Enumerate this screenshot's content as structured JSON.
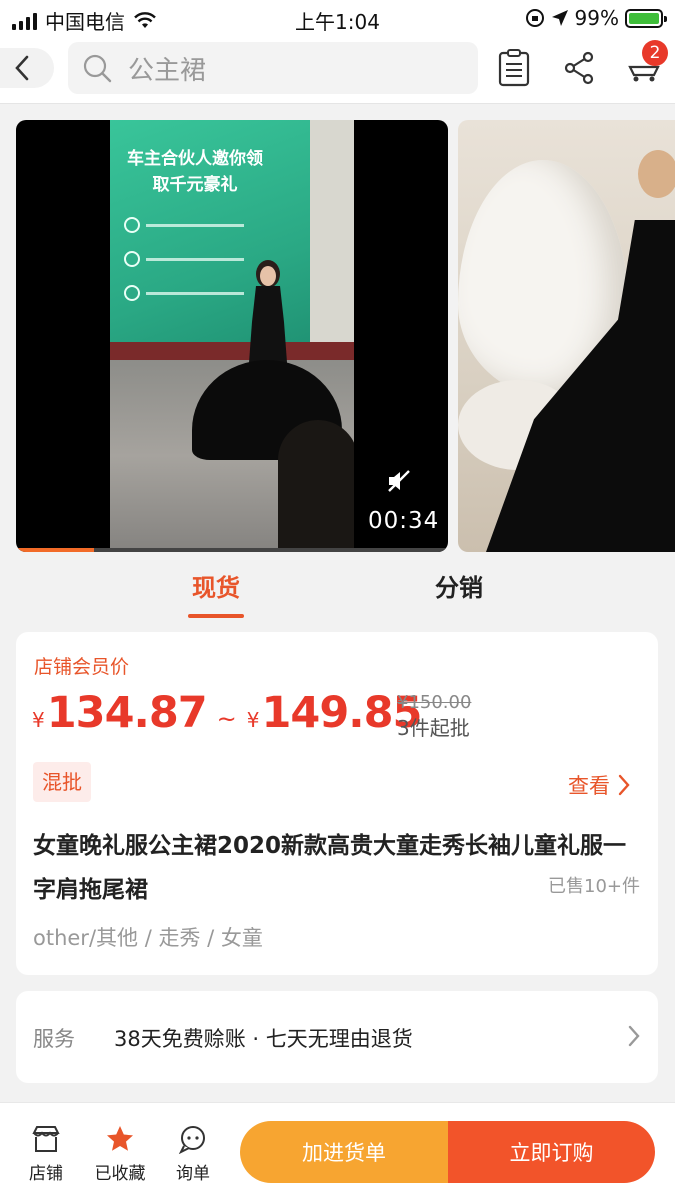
{
  "status_bar": {
    "carrier": "中国电信",
    "time": "上午1:04",
    "battery": "99%",
    "battery_level": 0.99
  },
  "header": {
    "search_placeholder": "公主裙",
    "cart_badge": "2",
    "icons": [
      "back-arrow-icon",
      "search-icon",
      "clipboard-icon",
      "share-icon",
      "cart-icon"
    ]
  },
  "media": {
    "video_screen_title": "车主合伙人邀你领取千元豪礼",
    "video_time": "00:34",
    "video_progress": 0.18
  },
  "tabs": [
    {
      "label": "现货",
      "active": true
    },
    {
      "label": "分销",
      "active": false
    }
  ],
  "product": {
    "member_price_label": "店铺会员价",
    "currency": "¥",
    "price_low": "134.87",
    "price_high": "149.85",
    "price_sep": "~",
    "original_price": "¥150.00",
    "moq": "3件起批",
    "mixed_tag": "混批",
    "view_link": "查看",
    "title": "女童晚礼服公主裙2020新款高贵大童走秀长袖儿童礼服一字肩拖尾裙",
    "sold": "已售10+件",
    "tags": "other/其他 / 走秀 / 女童"
  },
  "service": {
    "label": "服务",
    "text": "38天免费赊账 · 七天无理由退货"
  },
  "bottom_bar": {
    "shop_label": "店铺",
    "fav_label": "已收藏",
    "inquiry_label": "询单",
    "add_cart_label": "加进货单",
    "order_label": "立即订购"
  },
  "colors": {
    "accent": "#e8552a",
    "price": "#e8392a",
    "cart_button": "#f7a531",
    "order_button": "#f2542a"
  }
}
